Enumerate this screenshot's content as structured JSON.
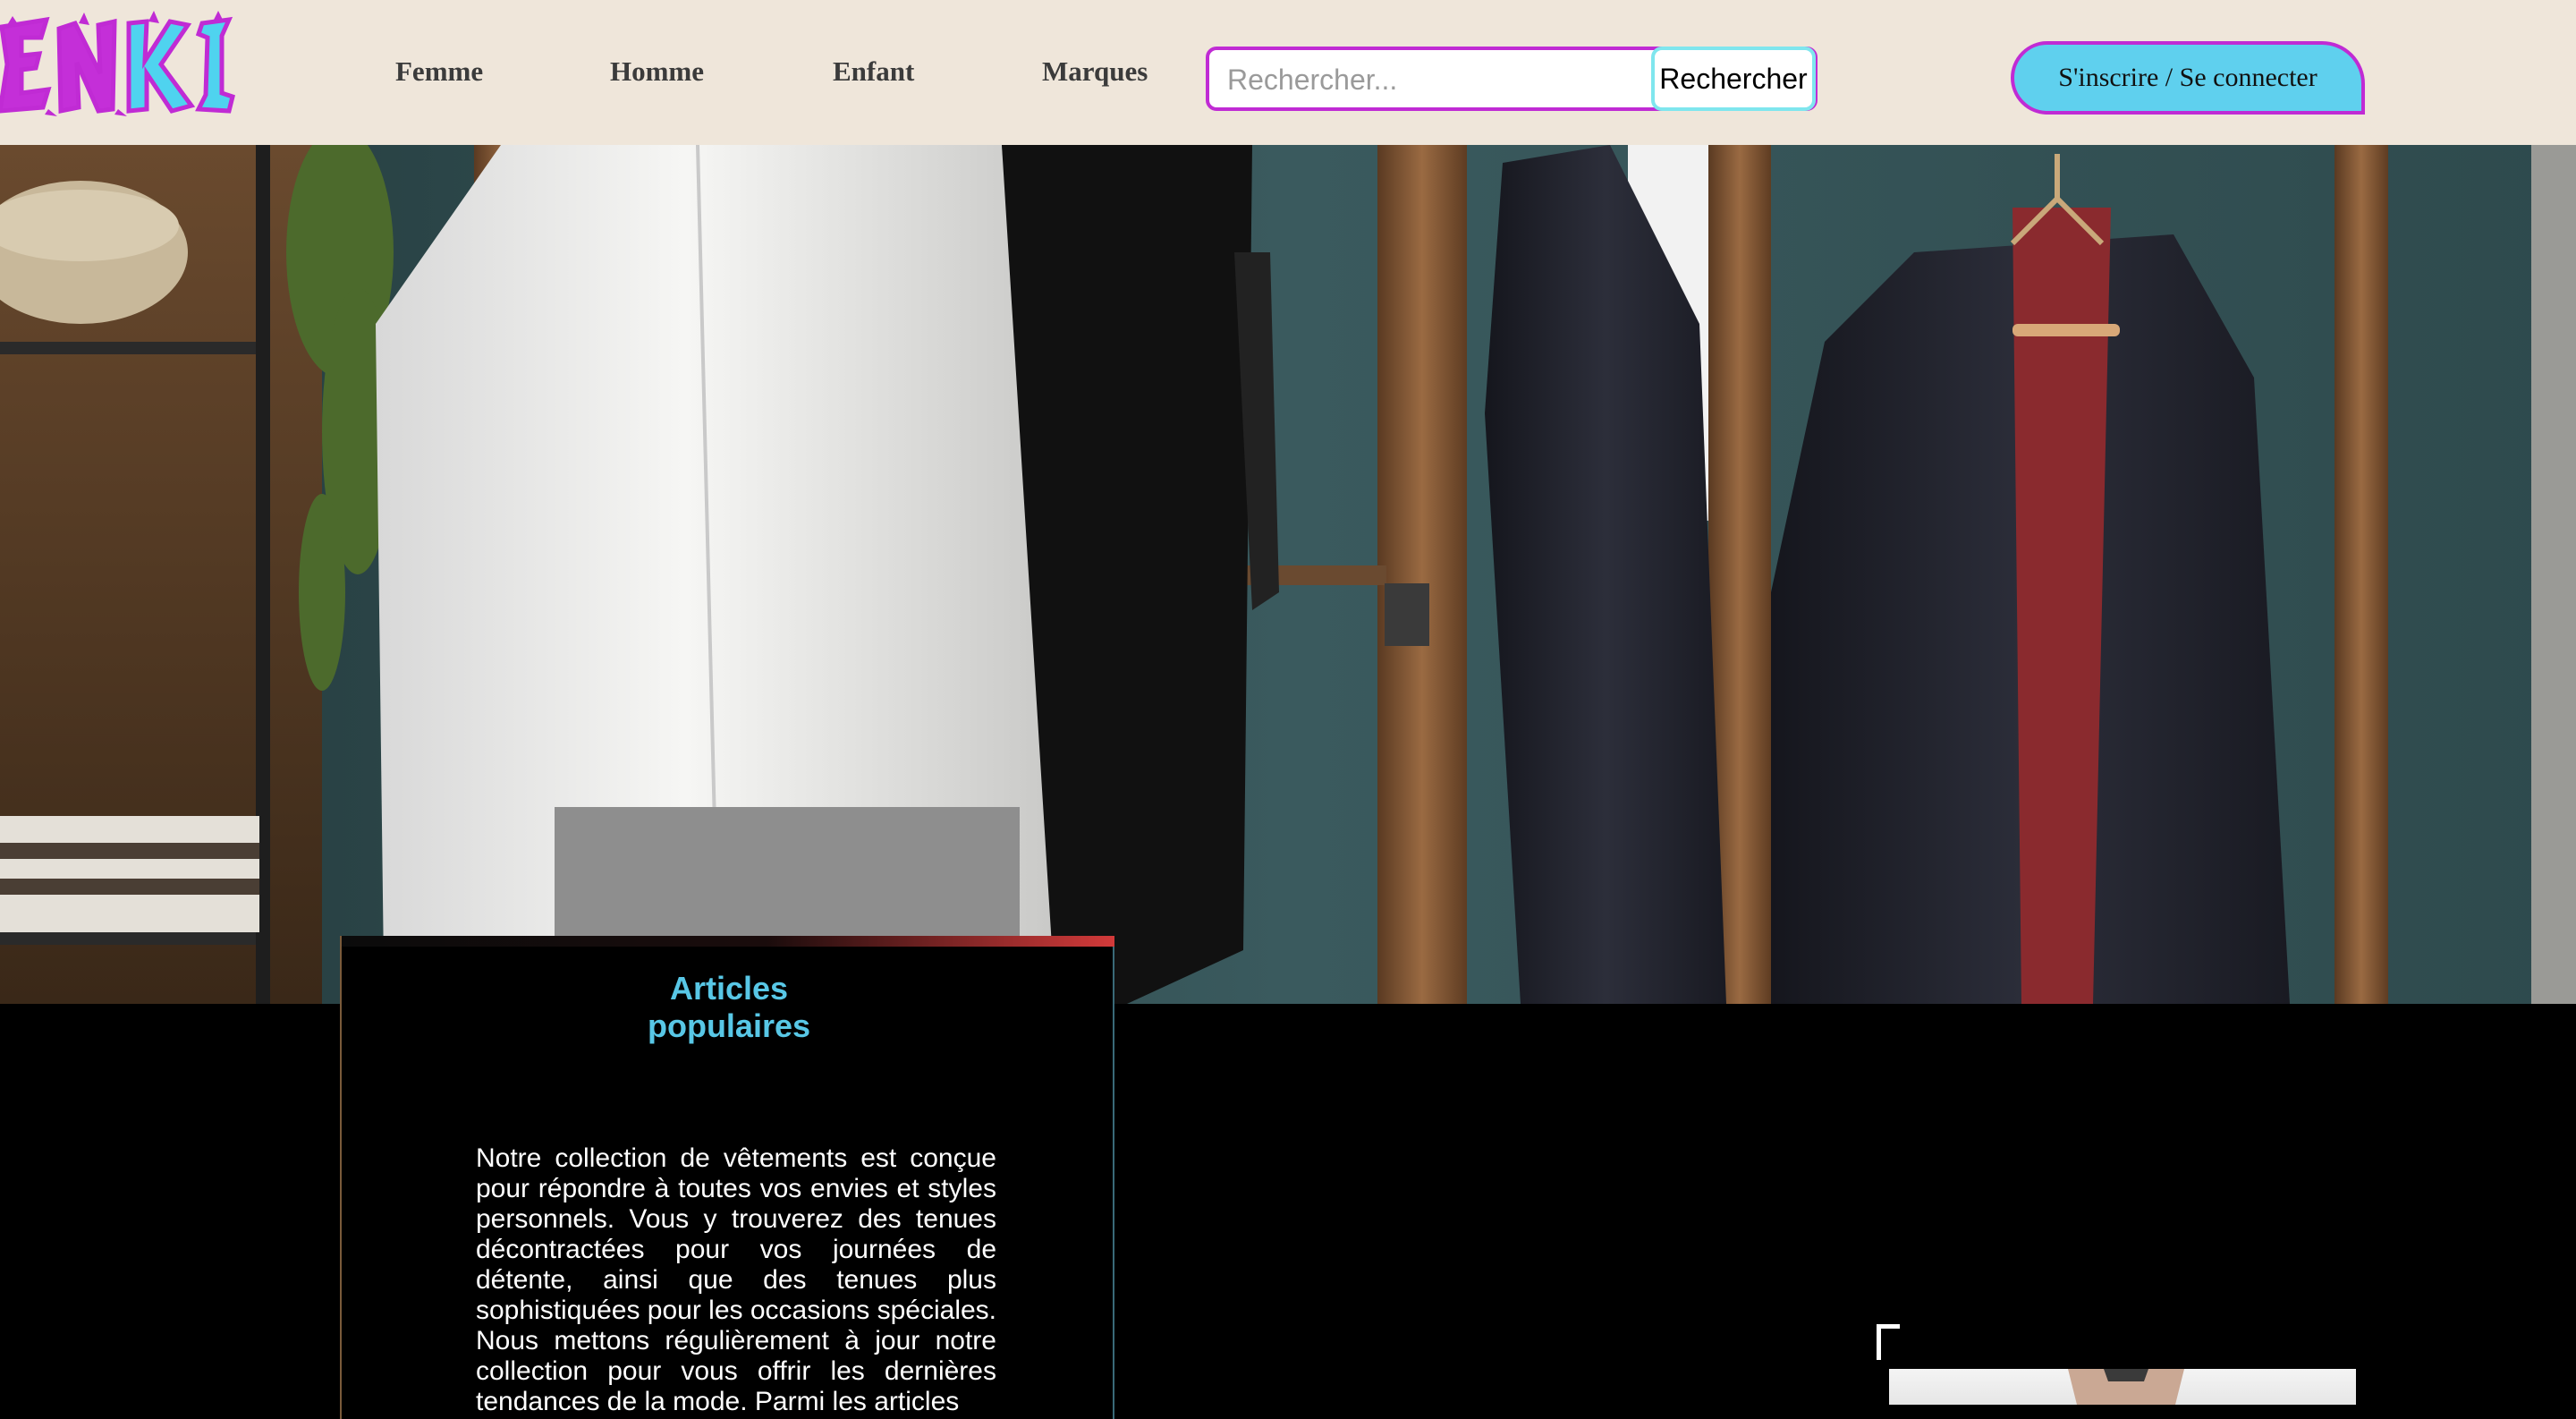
{
  "brand": {
    "logo_text": "ENKI",
    "colors": {
      "logo_cyan": "#4fd3ef",
      "logo_magenta": "#c02bd4"
    }
  },
  "nav": {
    "items": [
      {
        "label": "Femme"
      },
      {
        "label": "Homme"
      },
      {
        "label": "Enfant"
      },
      {
        "label": "Marques"
      }
    ]
  },
  "search": {
    "placeholder": "Rechercher...",
    "value": "",
    "button_label": "Rechercher"
  },
  "auth": {
    "login_label": "S'inscrire / Se connecter"
  },
  "hero": {
    "image": "clothing-rack-photo"
  },
  "popular": {
    "title": "Articles populaires",
    "text": "Notre collection de vêtements est conçue pour répondre à toutes vos envies et styles personnels. Vous y trouverez des tenues décontractées pour vos journées de détente, ainsi que des tenues plus sophistiquées pour les occasions spéciales. Nous mettons régulièrement à jour notre collection pour vous offrir les dernières tendances de la mode. Parmi les articles"
  },
  "colors": {
    "header_bg": "#efe6da",
    "page_bg": "#000000",
    "accent_cyan": "#58c7e6",
    "accent_magenta": "#c02bd4"
  }
}
